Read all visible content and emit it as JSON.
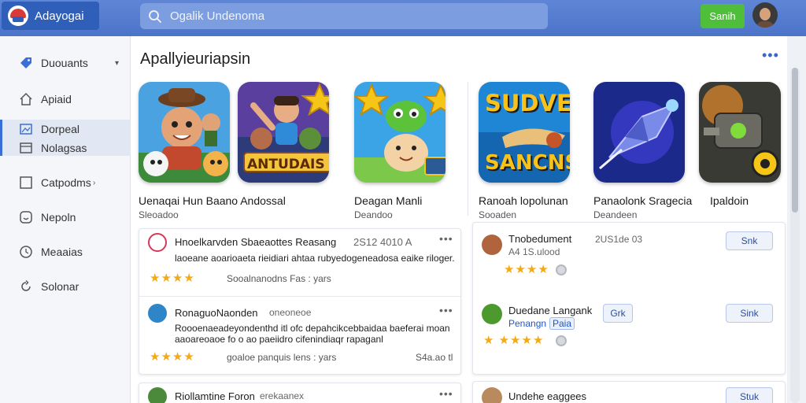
{
  "app": {
    "name": "Adayogai"
  },
  "search": {
    "placeholder": "Ogalik Undenoma"
  },
  "header": {
    "button_label": "Sanih"
  },
  "sidebar": {
    "items": [
      {
        "label": "Duouants",
        "icon": "tag-icon"
      },
      {
        "label": "Apiaid",
        "icon": "home-icon"
      },
      {
        "label": "Dorpeal",
        "icon": "image-icon"
      },
      {
        "label": "Nolagsas",
        "icon": "window-icon"
      },
      {
        "label": "Catpodms",
        "icon": "checkbox-icon"
      },
      {
        "label": "Nepoln",
        "icon": "smile-icon"
      },
      {
        "label": "Meaaias",
        "icon": "clock-icon"
      },
      {
        "label": "Solonar",
        "icon": "refresh-icon"
      }
    ]
  },
  "main": {
    "title": "Apallyieuriapsin",
    "tiles": [
      {
        "name": "tile-adventure",
        "art_text": ""
      },
      {
        "name": "tile-antuouais",
        "art_text": "ANTUDAIS"
      },
      {
        "name": "tile-dino",
        "art_text": ""
      },
      {
        "name": "tile-sudve",
        "art_text_top": "SUDVE",
        "art_text_bottom": "SANCNS"
      },
      {
        "name": "tile-spaceship",
        "art_text": ""
      },
      {
        "name": "tile-robot",
        "art_text": ""
      }
    ],
    "games": [
      {
        "title": "Uenaqai Hun Baano Andossal",
        "sub": "Sleoadoo"
      },
      {
        "title": "Deagan Manli",
        "sub": "Deandoo"
      },
      {
        "title": "Ranoah lopolunan",
        "sub": "Sooaden"
      },
      {
        "title": "Panaolonk Sragecia",
        "sub": "Deandeen"
      },
      {
        "title": "Ipaldoin",
        "sub": ""
      }
    ]
  },
  "reviews_left": [
    {
      "name": "Hnoelkarvden Sbaeaottes Reasang",
      "date": "2S12 4010 A",
      "body": "laoeane aoarioaeta rieidiari ahtaa rubyedogeneadosa eaike riloger.",
      "stars": "★★★★",
      "meta": "Sooalnanodns Fas : yars",
      "extra": ""
    },
    {
      "name": "RonaguoNaonden",
      "date": "oneoneoe",
      "body1": "Roooenaeadeyondenthd itl ofc depahcikcebbaidaa baeferai moan",
      "body2": "aaoareoaoe fo o ao paeiidro cifenindiaqr rapaganl",
      "stars": "★★★★",
      "meta": "goaloe panquis lens : yars",
      "extra": "S4a.ao tl"
    },
    {
      "name": "Riollamtine Foron",
      "date": "erekaanex"
    }
  ],
  "reviews_right": [
    {
      "name": "Tnobedument",
      "date": "2US1de 03",
      "sub": "A4 1S.ulood",
      "stars": "★★★★",
      "button": "Snk"
    },
    {
      "name": "Duedane Langank",
      "tag_left": "Penangn",
      "tag": "Paia",
      "stars": "★ ★★★★",
      "side_button": "Grk",
      "button": "Sink"
    },
    {
      "name": "Undehe eaggees",
      "button": "Stuk"
    }
  ],
  "colors": {
    "accent": "#3b6fd8",
    "topbar": "#4b73c8",
    "action_green": "#4fbf3b",
    "star": "#f4a915"
  }
}
